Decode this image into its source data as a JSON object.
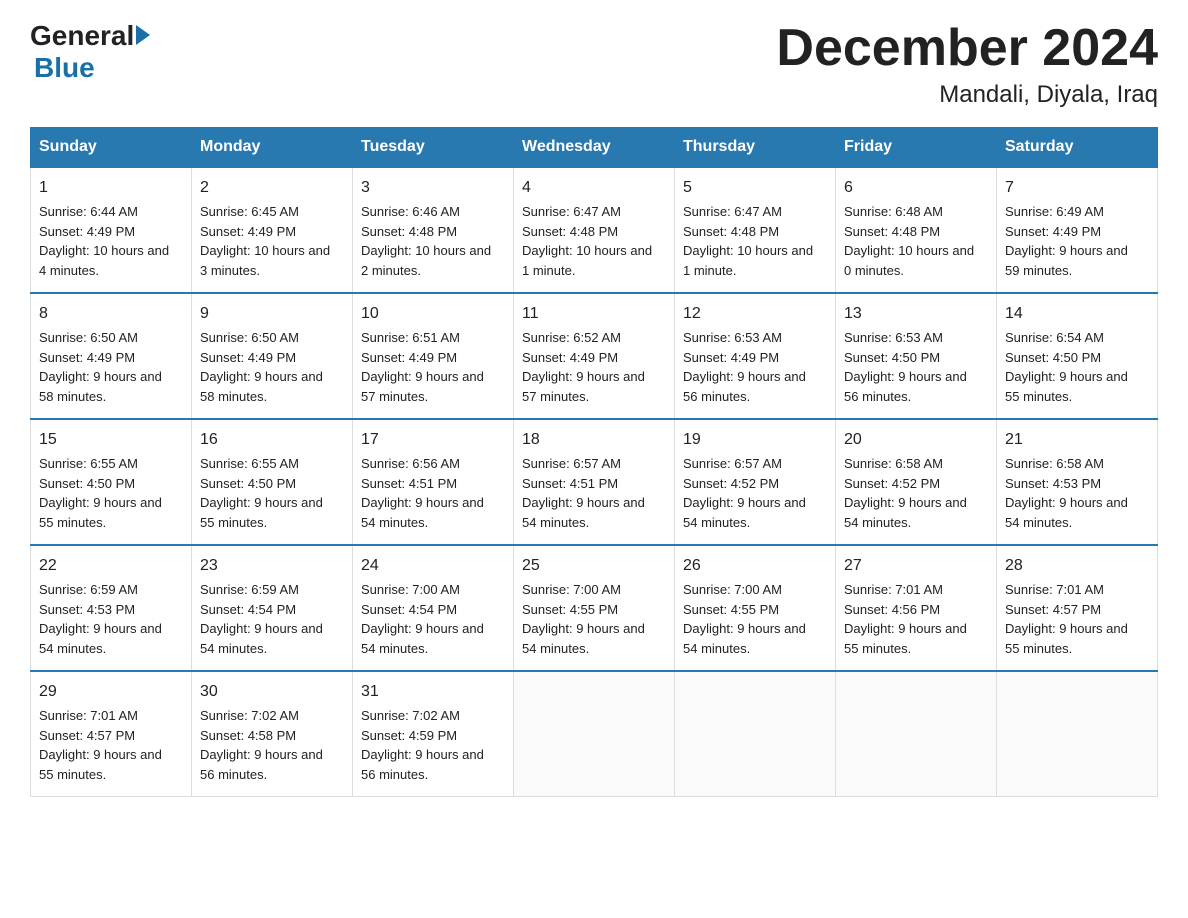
{
  "header": {
    "title": "December 2024",
    "subtitle": "Mandali, Diyala, Iraq",
    "logo_general": "General",
    "logo_blue": "Blue"
  },
  "weekdays": [
    "Sunday",
    "Monday",
    "Tuesday",
    "Wednesday",
    "Thursday",
    "Friday",
    "Saturday"
  ],
  "weeks": [
    [
      {
        "day": "1",
        "sunrise": "6:44 AM",
        "sunset": "4:49 PM",
        "daylight": "10 hours and 4 minutes."
      },
      {
        "day": "2",
        "sunrise": "6:45 AM",
        "sunset": "4:49 PM",
        "daylight": "10 hours and 3 minutes."
      },
      {
        "day": "3",
        "sunrise": "6:46 AM",
        "sunset": "4:48 PM",
        "daylight": "10 hours and 2 minutes."
      },
      {
        "day": "4",
        "sunrise": "6:47 AM",
        "sunset": "4:48 PM",
        "daylight": "10 hours and 1 minute."
      },
      {
        "day": "5",
        "sunrise": "6:47 AM",
        "sunset": "4:48 PM",
        "daylight": "10 hours and 1 minute."
      },
      {
        "day": "6",
        "sunrise": "6:48 AM",
        "sunset": "4:48 PM",
        "daylight": "10 hours and 0 minutes."
      },
      {
        "day": "7",
        "sunrise": "6:49 AM",
        "sunset": "4:49 PM",
        "daylight": "9 hours and 59 minutes."
      }
    ],
    [
      {
        "day": "8",
        "sunrise": "6:50 AM",
        "sunset": "4:49 PM",
        "daylight": "9 hours and 58 minutes."
      },
      {
        "day": "9",
        "sunrise": "6:50 AM",
        "sunset": "4:49 PM",
        "daylight": "9 hours and 58 minutes."
      },
      {
        "day": "10",
        "sunrise": "6:51 AM",
        "sunset": "4:49 PM",
        "daylight": "9 hours and 57 minutes."
      },
      {
        "day": "11",
        "sunrise": "6:52 AM",
        "sunset": "4:49 PM",
        "daylight": "9 hours and 57 minutes."
      },
      {
        "day": "12",
        "sunrise": "6:53 AM",
        "sunset": "4:49 PM",
        "daylight": "9 hours and 56 minutes."
      },
      {
        "day": "13",
        "sunrise": "6:53 AM",
        "sunset": "4:50 PM",
        "daylight": "9 hours and 56 minutes."
      },
      {
        "day": "14",
        "sunrise": "6:54 AM",
        "sunset": "4:50 PM",
        "daylight": "9 hours and 55 minutes."
      }
    ],
    [
      {
        "day": "15",
        "sunrise": "6:55 AM",
        "sunset": "4:50 PM",
        "daylight": "9 hours and 55 minutes."
      },
      {
        "day": "16",
        "sunrise": "6:55 AM",
        "sunset": "4:50 PM",
        "daylight": "9 hours and 55 minutes."
      },
      {
        "day": "17",
        "sunrise": "6:56 AM",
        "sunset": "4:51 PM",
        "daylight": "9 hours and 54 minutes."
      },
      {
        "day": "18",
        "sunrise": "6:57 AM",
        "sunset": "4:51 PM",
        "daylight": "9 hours and 54 minutes."
      },
      {
        "day": "19",
        "sunrise": "6:57 AM",
        "sunset": "4:52 PM",
        "daylight": "9 hours and 54 minutes."
      },
      {
        "day": "20",
        "sunrise": "6:58 AM",
        "sunset": "4:52 PM",
        "daylight": "9 hours and 54 minutes."
      },
      {
        "day": "21",
        "sunrise": "6:58 AM",
        "sunset": "4:53 PM",
        "daylight": "9 hours and 54 minutes."
      }
    ],
    [
      {
        "day": "22",
        "sunrise": "6:59 AM",
        "sunset": "4:53 PM",
        "daylight": "9 hours and 54 minutes."
      },
      {
        "day": "23",
        "sunrise": "6:59 AM",
        "sunset": "4:54 PM",
        "daylight": "9 hours and 54 minutes."
      },
      {
        "day": "24",
        "sunrise": "7:00 AM",
        "sunset": "4:54 PM",
        "daylight": "9 hours and 54 minutes."
      },
      {
        "day": "25",
        "sunrise": "7:00 AM",
        "sunset": "4:55 PM",
        "daylight": "9 hours and 54 minutes."
      },
      {
        "day": "26",
        "sunrise": "7:00 AM",
        "sunset": "4:55 PM",
        "daylight": "9 hours and 54 minutes."
      },
      {
        "day": "27",
        "sunrise": "7:01 AM",
        "sunset": "4:56 PM",
        "daylight": "9 hours and 55 minutes."
      },
      {
        "day": "28",
        "sunrise": "7:01 AM",
        "sunset": "4:57 PM",
        "daylight": "9 hours and 55 minutes."
      }
    ],
    [
      {
        "day": "29",
        "sunrise": "7:01 AM",
        "sunset": "4:57 PM",
        "daylight": "9 hours and 55 minutes."
      },
      {
        "day": "30",
        "sunrise": "7:02 AM",
        "sunset": "4:58 PM",
        "daylight": "9 hours and 56 minutes."
      },
      {
        "day": "31",
        "sunrise": "7:02 AM",
        "sunset": "4:59 PM",
        "daylight": "9 hours and 56 minutes."
      },
      null,
      null,
      null,
      null
    ]
  ],
  "labels": {
    "sunrise": "Sunrise:",
    "sunset": "Sunset:",
    "daylight": "Daylight:"
  }
}
